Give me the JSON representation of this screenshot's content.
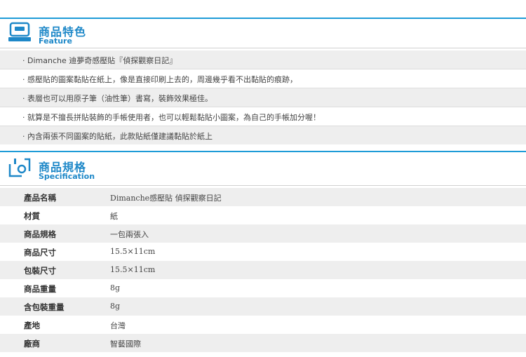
{
  "feature": {
    "title_zh": "商品特色",
    "title_en": "Feature",
    "items": [
      "Dimanche 迪夢奇感壓貼『偵探觀察日記』",
      "感壓貼的圖案黏貼在紙上，像是直接印刷上去的，周邊幾乎看不出黏貼的痕跡，",
      "表層也可以用原子筆（油性筆）書寫，裝飾效果極佳。",
      "就算是不擅長拼貼裝飾的手帳使用者，也可以輕鬆黏貼小圖案，為自己的手帳加分喔！",
      "內含兩張不同圖案的貼紙，此款貼紙僅建議黏貼於紙上"
    ]
  },
  "spec": {
    "title_zh": "商品規格",
    "title_en": "Specification",
    "rows": [
      {
        "key": "產品名稱",
        "value": "Dimanche感壓貼 偵探觀察日記"
      },
      {
        "key": "材質",
        "value": "紙"
      },
      {
        "key": "商品規格",
        "value": "一包兩張入"
      },
      {
        "key": "商品尺寸",
        "value": "15.5×11cm"
      },
      {
        "key": "包裝尺寸",
        "value": "15.5×11cm"
      },
      {
        "key": "商品重量",
        "value": "8g"
      },
      {
        "key": "含包裝重量",
        "value": "8g"
      },
      {
        "key": "產地",
        "value": "台灣"
      },
      {
        "key": "廠商",
        "value": "智藝國際"
      }
    ]
  },
  "colors": {
    "accent": "#1e88c8",
    "rule": "#1e9bd7",
    "row_shade": "#eeeeee"
  },
  "icons": {
    "feature": "register-icon",
    "spec": "box-spec-icon"
  }
}
